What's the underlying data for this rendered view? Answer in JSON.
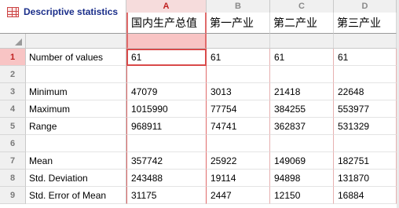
{
  "sheet": {
    "title": "Descriptive statistics",
    "icon": "table-icon"
  },
  "columns": [
    {
      "letter": "A",
      "title": "国内生产总值",
      "selected": true
    },
    {
      "letter": "B",
      "title": "第一产业",
      "selected": false
    },
    {
      "letter": "C",
      "title": "第二产业",
      "selected": false
    },
    {
      "letter": "D",
      "title": "第三产业",
      "selected": false
    }
  ],
  "rows": [
    {
      "num": "1",
      "label": "Number of values",
      "values": [
        "61",
        "61",
        "61",
        "61"
      ],
      "selected": true
    },
    {
      "num": "2",
      "label": "",
      "values": [
        "",
        "",
        "",
        ""
      ],
      "selected": false
    },
    {
      "num": "3",
      "label": "Minimum",
      "values": [
        "47079",
        "3013",
        "21418",
        "22648"
      ],
      "selected": false
    },
    {
      "num": "4",
      "label": "Maximum",
      "values": [
        "1015990",
        "77754",
        "384255",
        "553977"
      ],
      "selected": false
    },
    {
      "num": "5",
      "label": "Range",
      "values": [
        "968911",
        "74741",
        "362837",
        "531329"
      ],
      "selected": false
    },
    {
      "num": "6",
      "label": "",
      "values": [
        "",
        "",
        "",
        ""
      ],
      "selected": false
    },
    {
      "num": "7",
      "label": "Mean",
      "values": [
        "357742",
        "25922",
        "149069",
        "182751"
      ],
      "selected": false
    },
    {
      "num": "8",
      "label": "Std. Deviation",
      "values": [
        "243488",
        "19114",
        "94898",
        "131870"
      ],
      "selected": false
    },
    {
      "num": "9",
      "label": "Std. Error of Mean",
      "values": [
        "31175",
        "2447",
        "12150",
        "16884"
      ],
      "selected": false
    }
  ],
  "colors": {
    "selection": "#e06b6b",
    "header_bg": "#f0f0f0",
    "title_text": "#1a2e8a"
  }
}
